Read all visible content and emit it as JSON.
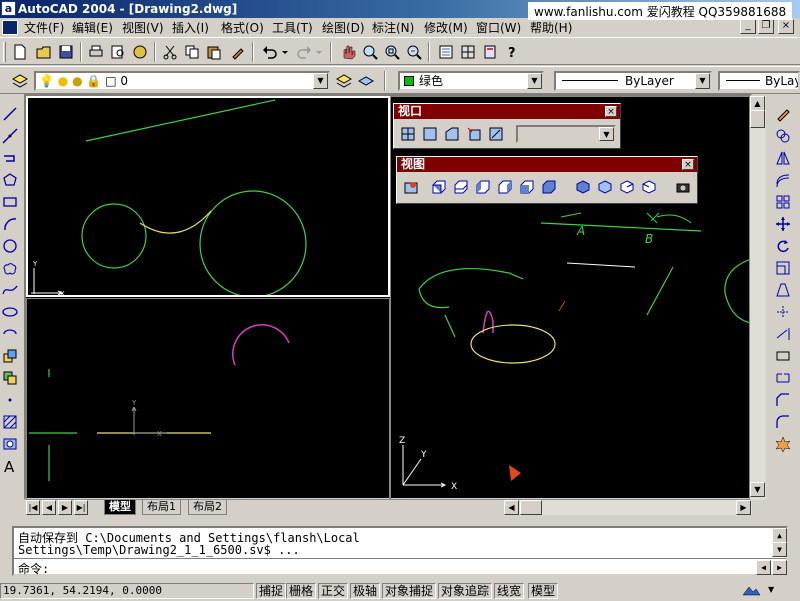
{
  "window": {
    "title": "AutoCAD 2004 - [Drawing2.dwg]",
    "app_icon": "a"
  },
  "watermark": "www.fanlishu.com 爱闪教程 QQ359881688",
  "menu": [
    {
      "label": "文件(F)"
    },
    {
      "label": "编辑(E)"
    },
    {
      "label": "视图(V)"
    },
    {
      "label": "插入(I)"
    },
    {
      "label": "格式(O)"
    },
    {
      "label": "工具(T)"
    },
    {
      "label": "绘图(D)"
    },
    {
      "label": "标注(N)"
    },
    {
      "label": "修改(M)"
    },
    {
      "label": "窗口(W)"
    },
    {
      "label": "帮助(H)"
    }
  ],
  "window_controls": {
    "minimize": "_",
    "restore": "❐",
    "close": "×"
  },
  "layer_toolbar": {
    "layer_value": "0"
  },
  "properties_toolbar": {
    "color_value": "绿色",
    "color_swatch": "#00c000",
    "linetype_value": "ByLayer",
    "lineweight_value": "ByLay"
  },
  "viewport_toolbar": {
    "title": "视口",
    "close": "×"
  },
  "view_toolbar": {
    "title": "视图",
    "close": "×"
  },
  "layout_tabs": [
    {
      "label": "模型",
      "selected": true
    },
    {
      "label": "布局1"
    },
    {
      "label": "布局2"
    }
  ],
  "command_window": {
    "line1": "自动保存到 C:\\Documents and Settings\\flansh\\Local",
    "line2": "Settings\\Temp\\Drawing2_1_1_6500.sv$ ...",
    "line3": "命令:"
  },
  "status_bar": {
    "coordinates": "19.7361, 54.2194, 0.0000",
    "toggles": [
      {
        "label": "捕捉"
      },
      {
        "label": "栅格"
      },
      {
        "label": "正交"
      },
      {
        "label": "极轴"
      },
      {
        "label": "对象捕捉"
      },
      {
        "label": "对象追踪"
      },
      {
        "label": "线宽"
      },
      {
        "label": "模型"
      }
    ]
  },
  "ucs_labels": {
    "x": "X",
    "y": "Y",
    "z": "Z"
  },
  "drawing_text": {
    "label_a": "A",
    "label_b": "B"
  },
  "colors": {
    "drawing_bg": "#000000",
    "green": "#40d040",
    "yellow": "#e8e070",
    "magenta": "#d040c0",
    "title_active": "#0a246a",
    "toolbar_title": "#800000"
  }
}
